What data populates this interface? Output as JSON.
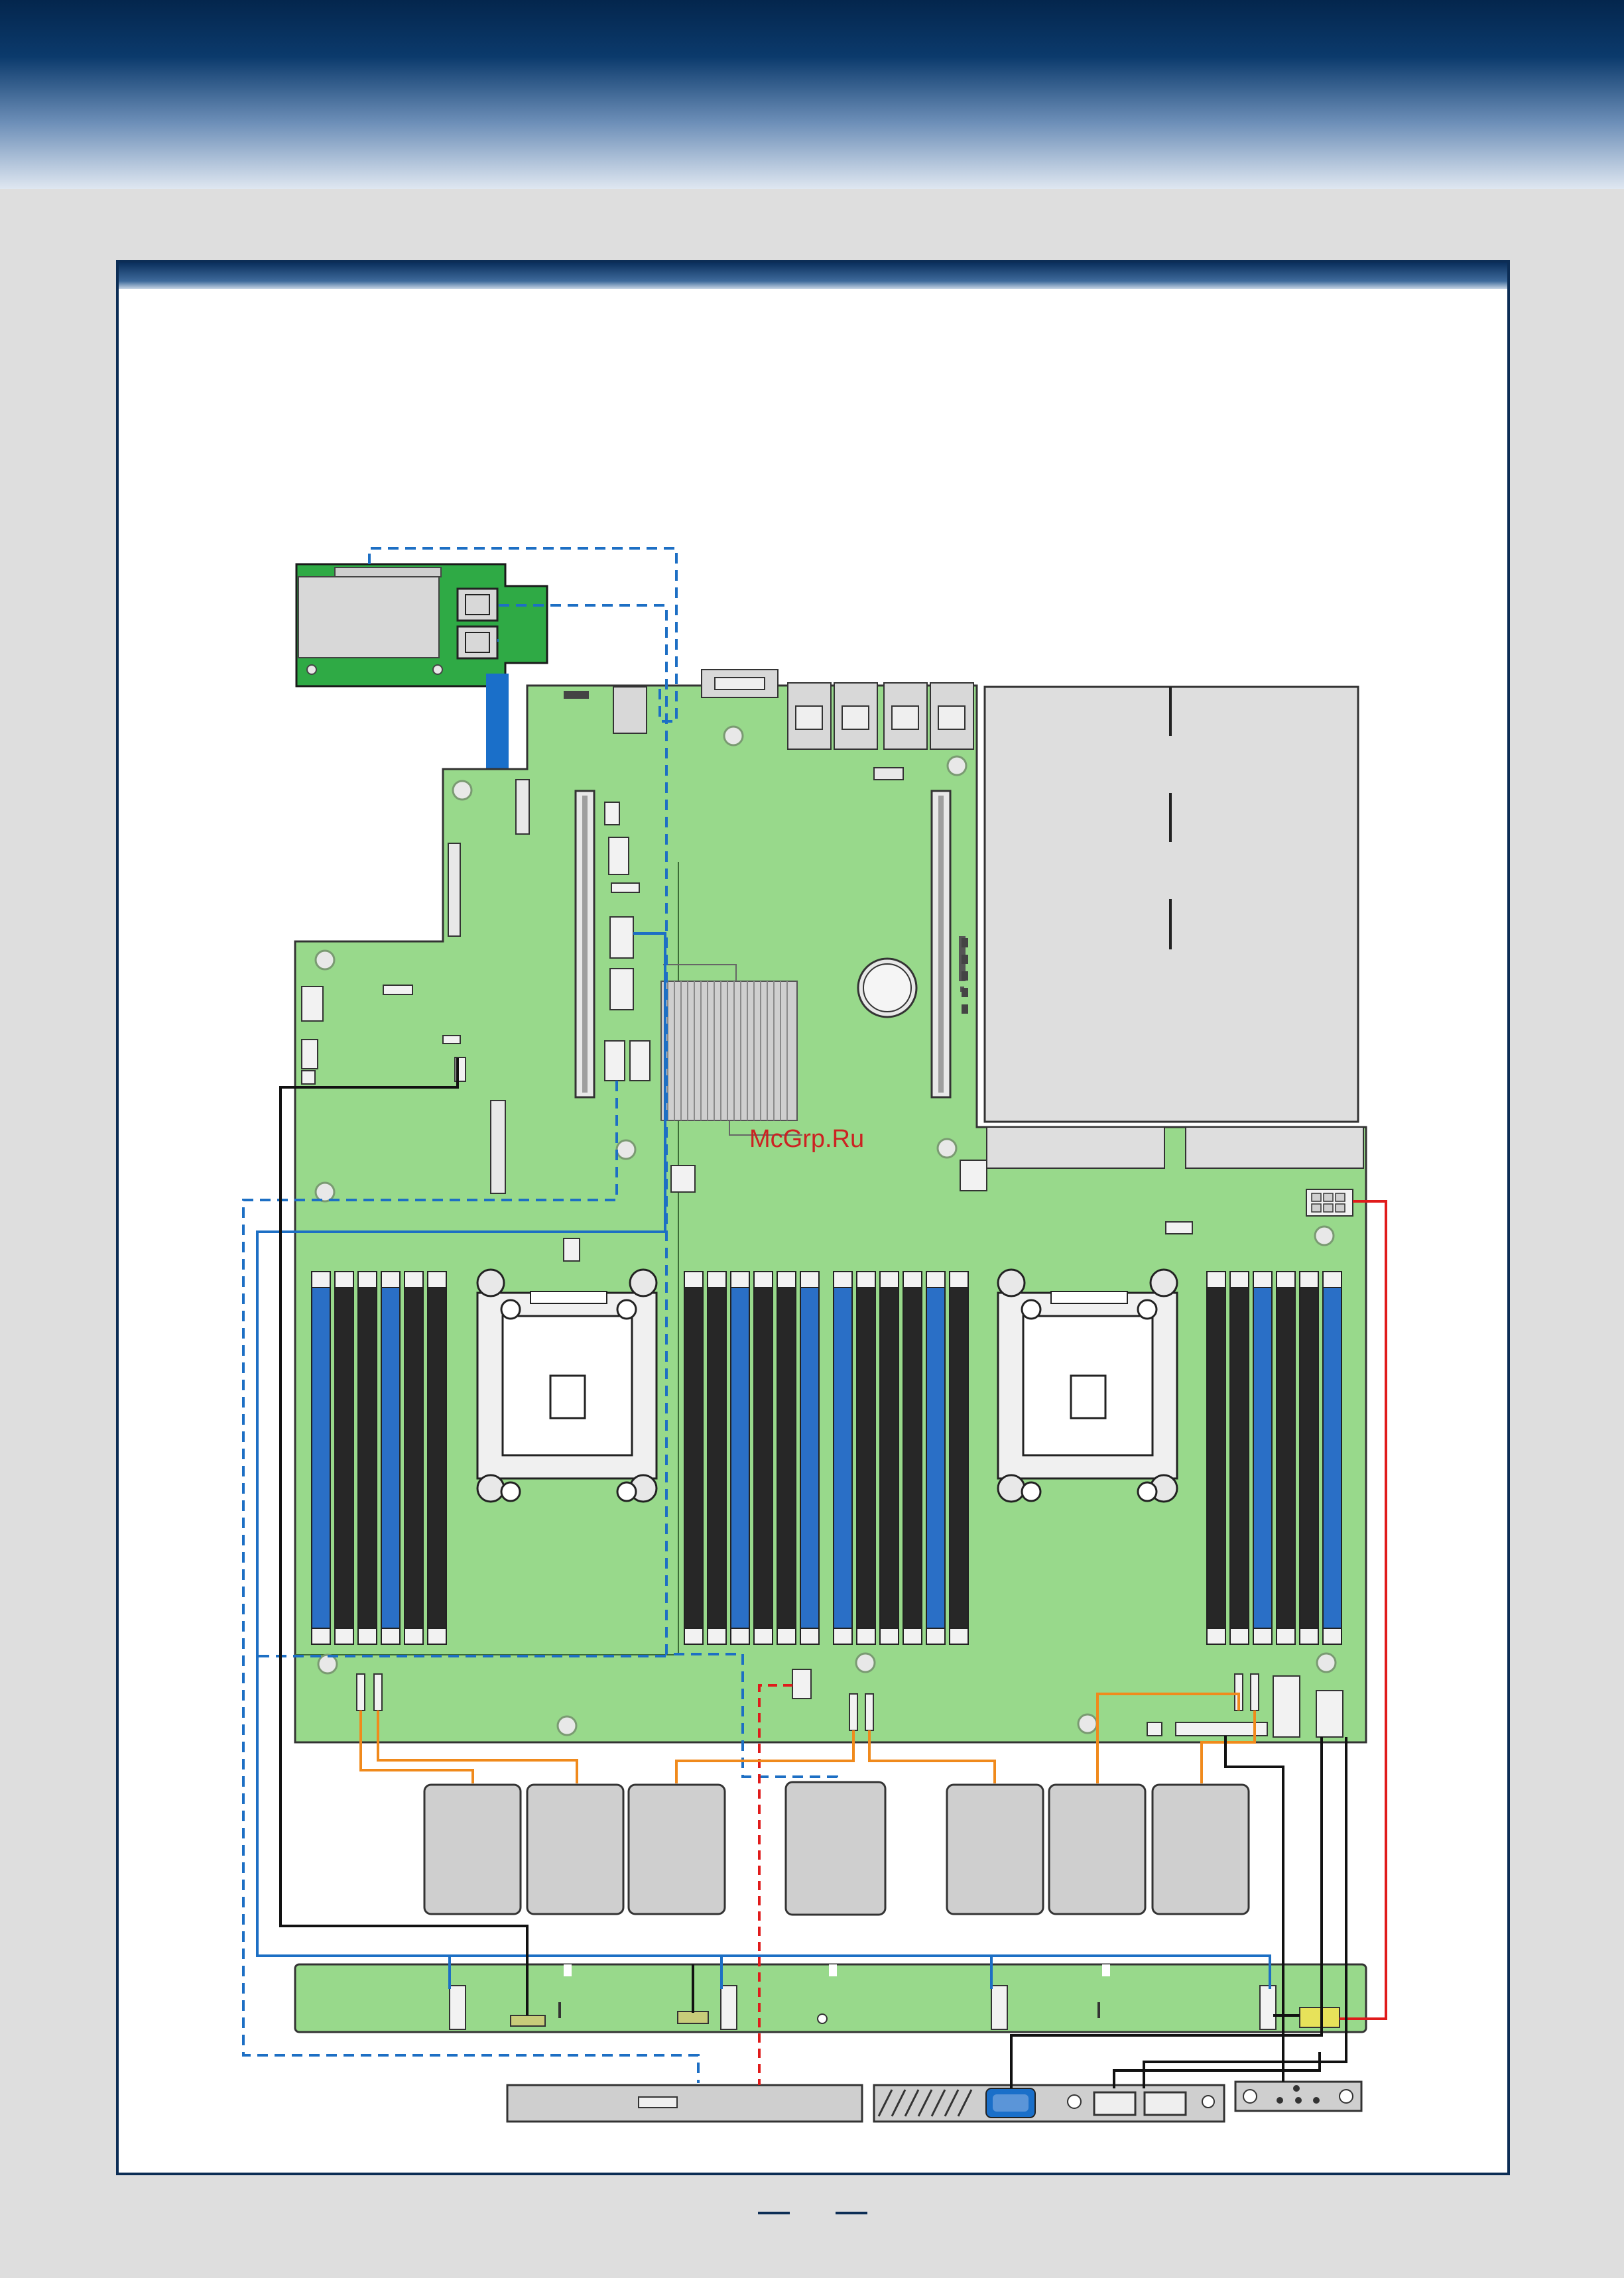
{
  "watermark": "McGrp.Ru",
  "colors": {
    "board": "#98d98b",
    "board_stroke": "#333333",
    "raid_card": "#2faa45",
    "dimm_blue": "#2a6fc6",
    "dimm_black": "#272727",
    "sas_cable": "#1d6fc4",
    "power_cable": "#e01b1b",
    "fan_cable": "#f08a1c",
    "signal_cable": "#111111",
    "psu_bay": "#dedede",
    "watermark": "#cc2222"
  },
  "icons": {
    "insert_arrow": "down-arrow-icon",
    "mount_hole": "standoff-icon",
    "battery": "coin-cell-icon"
  }
}
